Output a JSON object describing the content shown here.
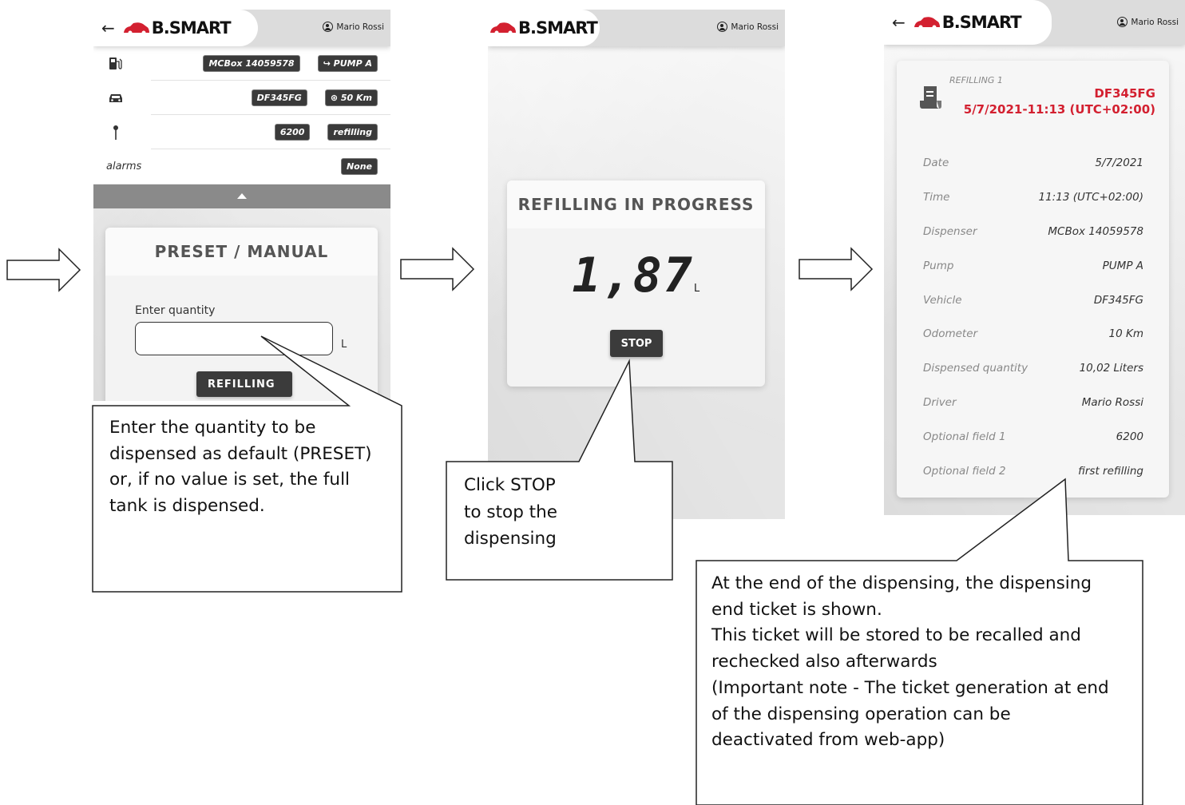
{
  "brand": {
    "logo_text": "B.SMART",
    "accent_color": "#d32030"
  },
  "user": {
    "name": "Mario Rossi",
    "icon": "user-circle-icon"
  },
  "screen1": {
    "back_icon": "back-arrow-icon",
    "rows": [
      {
        "icon": "fuel-pump-icon",
        "chips": [
          "MCBox 14059578",
          "↪ PUMP A"
        ]
      },
      {
        "icon": "car-icon",
        "chips": [
          "DF345FG",
          "⊛ 50 Km"
        ]
      },
      {
        "icon": "pin-icon",
        "chips": [
          "6200",
          "refilling"
        ]
      },
      {
        "label": "alarms",
        "chips": [
          "None"
        ]
      }
    ],
    "preset_card": {
      "title": "PRESET / MANUAL",
      "quantity_label": "Enter quantity",
      "quantity_value": "",
      "unit": "L",
      "button": "REFILLING"
    }
  },
  "screen2": {
    "card_title": "REFILLING IN PROGRESS",
    "quantity": "1,87",
    "unit": "L",
    "stop_button": "STOP"
  },
  "screen3": {
    "back_icon": "back-arrow-icon",
    "ticket_icon": "receipt-icon",
    "subtitle": "REFILLING 1",
    "plate": "DF345FG",
    "datetime": "5/7/2021-11:13 (UTC+02:00)",
    "fields": [
      {
        "key": "Date",
        "value": "5/7/2021"
      },
      {
        "key": "Time",
        "value": "11:13 (UTC+02:00)"
      },
      {
        "key": "Dispenser",
        "value": "MCBox 14059578"
      },
      {
        "key": "Pump",
        "value": "PUMP A"
      },
      {
        "key": "Vehicle",
        "value": "DF345FG"
      },
      {
        "key": "Odometer",
        "value": "10 Km"
      },
      {
        "key": "Dispensed quantity",
        "value": "10,02 Liters"
      },
      {
        "key": "Driver",
        "value": "Mario Rossi"
      },
      {
        "key": "Optional field 1",
        "value": "6200"
      },
      {
        "key": "Optional field 2",
        "value": "first refilling"
      }
    ]
  },
  "callouts": {
    "preset": [
      "Enter the quantity to be",
      "dispensed as default (PRESET)",
      "or, if no value is set, the full",
      "tank is dispensed."
    ],
    "stop": [
      "Click STOP",
      "to stop the",
      "dispensing"
    ],
    "ticket": [
      "At the end of the dispensing, the dispensing",
      "end ticket is shown.",
      "This ticket will be stored to be recalled and",
      "rechecked also afterwards",
      "(Important note - The ticket generation at end",
      "of the dispensing operation can be",
      "deactivated from web-app)"
    ]
  }
}
